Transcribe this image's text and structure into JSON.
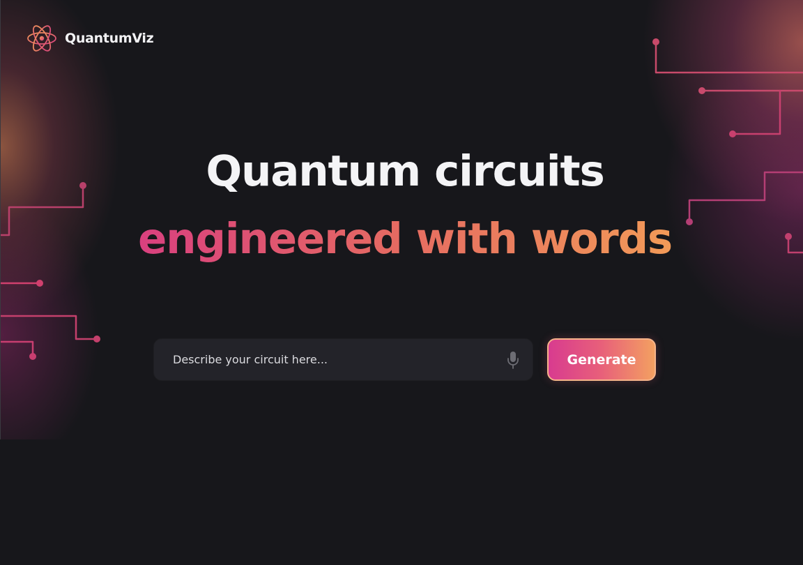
{
  "brand": {
    "name": "QuantumViz",
    "icon": "atom-icon"
  },
  "hero": {
    "headline": "Quantum circuits",
    "subline": "engineered with words"
  },
  "prompt": {
    "placeholder": "Describe your circuit here...",
    "value": "",
    "mic_icon": "microphone-icon"
  },
  "actions": {
    "generate_label": "Generate"
  },
  "colors": {
    "background": "#17171b",
    "accent_pink": "#d9407f",
    "accent_orange": "#f29a58",
    "circuit_line": "#c8406e"
  }
}
